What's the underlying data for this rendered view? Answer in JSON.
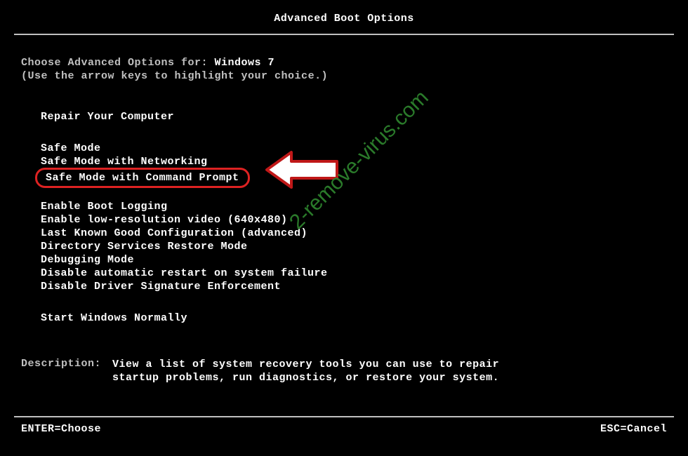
{
  "title": "Advanced Boot Options",
  "prompt": {
    "label": "Choose Advanced Options for: ",
    "os": "Windows 7",
    "hint": "(Use the arrow keys to highlight your choice.)"
  },
  "groups": [
    {
      "items": [
        "Repair Your Computer"
      ]
    },
    {
      "items": [
        "Safe Mode",
        "Safe Mode with Networking",
        "Safe Mode with Command Prompt"
      ],
      "highlighted_index": 2
    },
    {
      "items": [
        "Enable Boot Logging",
        "Enable low-resolution video (640x480)",
        "Last Known Good Configuration (advanced)",
        "Directory Services Restore Mode",
        "Debugging Mode",
        "Disable automatic restart on system failure",
        "Disable Driver Signature Enforcement"
      ]
    },
    {
      "items": [
        "Start Windows Normally"
      ]
    }
  ],
  "description": {
    "label": "Description:",
    "text": "View a list of system recovery tools you can use to repair startup problems, run diagnostics, or restore your system."
  },
  "footer": {
    "enter": "ENTER=Choose",
    "esc": "ESC=Cancel"
  },
  "watermark": "2-remove-virus.com",
  "colors": {
    "highlight_border": "#d22",
    "text": "#c0c0c0",
    "bright": "#ffffff",
    "bg": "#000000",
    "watermark": "#2a7a2a"
  }
}
